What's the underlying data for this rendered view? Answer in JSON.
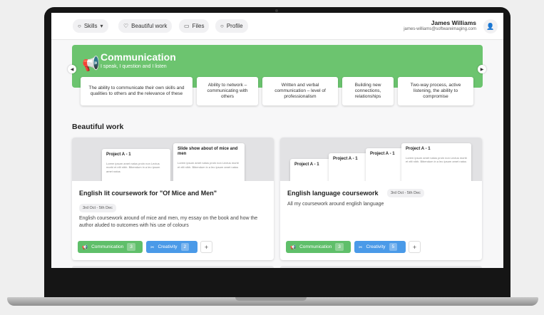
{
  "nav": {
    "skills": "Skills",
    "beautiful_work": "Beautiful work",
    "files": "Files",
    "profile": "Profile"
  },
  "user": {
    "name": "James Williams",
    "email": "james-williams@softwareimaging.com"
  },
  "banner": {
    "title": "Communication",
    "subtitle": "I speak, I question and I listen",
    "color": "#6cc46f",
    "cards": [
      "The ability to communicate their own skills and qualities to others and the relevance of these",
      "Ability to network – communicating with others",
      "Written and verbal communication – level of professionalism",
      "Building new connections, relationships",
      "Two-way process, active listening, the ability to compromise"
    ]
  },
  "section": {
    "title": "Beautiful work"
  },
  "cards": [
    {
      "title": "English lit coursework for \"Of Mice and Men\"",
      "date": "3rd Oct - 5th Dec",
      "description": "English coursework around of mice and men, my essay on the book and how the author aluded to outcomes with his use of colours",
      "docs": [
        "Project A - 1",
        "Slide show about of mice and men"
      ],
      "lorem": "Lorem ipsum amet natus proin non Lectus morbi et elit nibh. Bibendum in a leo ipsum amet natus",
      "tags": [
        {
          "label": "Communication",
          "count": "3"
        },
        {
          "label": "Creativity",
          "count": "2"
        }
      ],
      "add": "+"
    },
    {
      "title": "English language coursework",
      "date": "3rd Oct - 5th Dec",
      "description": "All my coursework around english language",
      "docs": [
        "Project A - 1",
        "Project A - 1",
        "Project A - 1",
        "Project A - 1"
      ],
      "lorem": "Lorem ipsum amet natus proin non Lectus morbi et elit nibh. Bibendum in a leo ipsum amet natus",
      "tags": [
        {
          "label": "Communication",
          "count": "3"
        },
        {
          "label": "Creativity",
          "count": "5"
        }
      ],
      "add": "+"
    }
  ],
  "colors": {
    "communication": "#5fbf6a",
    "creativity": "#4a9ae8"
  }
}
